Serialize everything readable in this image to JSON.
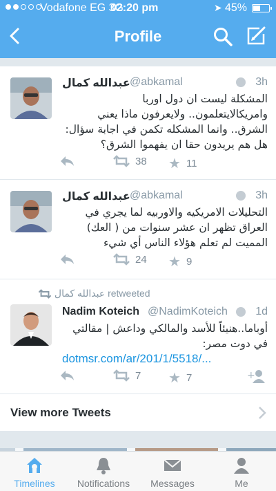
{
  "status": {
    "carrier": "Vodafone EG",
    "network": "3G",
    "time": "02:20 pm",
    "battery": "45%",
    "battery_level": 0.45
  },
  "nav": {
    "title": "Profile"
  },
  "tweets": [
    {
      "name": "عبدالله كمال",
      "handle": "@abkamal",
      "time": "3h",
      "text": "المشكلة ليست ان دول اوربا وامريكالايتعلمون.. ولايعرفون ماذا يعني الشرق.. وانما المشكله تكمن في اجابة سؤال: هل هم يريدون حقا ان يفهموا الشرق؟",
      "retweets": "38",
      "favorites": "11"
    },
    {
      "name": "عبدالله كمال",
      "handle": "@abkamal",
      "time": "3h",
      "text": "التحليلات الامريكيه والاوربيه لما يجري في العراق تظهر ان عشر سنوات من ( العك) المميت لم تعلم هؤلاء الناس أي شيء",
      "retweets": "24",
      "favorites": "9"
    },
    {
      "retweeted_by": "عبدالله كمال",
      "retweeted_label": "retweeted",
      "name": "Nadim Koteich",
      "handle": "@NadimKoteich",
      "time": "1d",
      "text": "أوباما..هنيئاً للأسد والمالكي وداعش | مقالتي في دوت مصر:",
      "link": "dotmsr.com/ar/201/1/5518/...",
      "retweets": "7",
      "favorites": "7"
    }
  ],
  "more": {
    "label": "View more Tweets"
  },
  "tabs": [
    {
      "label": "Timelines",
      "icon": "home-icon"
    },
    {
      "label": "Notifications",
      "icon": "bell-icon"
    },
    {
      "label": "Messages",
      "icon": "envelope-icon"
    },
    {
      "label": "Me",
      "icon": "person-icon"
    }
  ],
  "colors": {
    "brand": "#55acee",
    "link": "#1b95e0",
    "muted": "#8899a6"
  }
}
